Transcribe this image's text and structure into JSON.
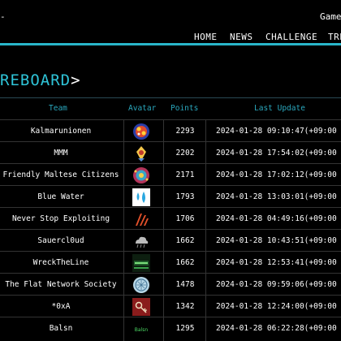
{
  "header": {
    "brand_fragment": "-",
    "site_title": "Game",
    "nav": [
      "HOME",
      "NEWS",
      "CHALLENGE",
      "TRE"
    ]
  },
  "page_title": "REBOARD",
  "page_title_caret": ">",
  "table": {
    "columns": [
      "Team",
      "Avatar",
      "Points",
      "Last Update"
    ],
    "rows": [
      {
        "team": "Kalmarunionen",
        "avatar": "kalmar-avatar-icon",
        "points": "2293",
        "update": "2024-01-28 09:10:47(+09:00"
      },
      {
        "team": "MMM",
        "avatar": "mmm-avatar-icon",
        "points": "2202",
        "update": "2024-01-28 17:54:02(+09:00"
      },
      {
        "team": "Friendly Maltese Citizens",
        "avatar": "fmc-avatar-icon",
        "points": "2171",
        "update": "2024-01-28 17:02:12(+09:00"
      },
      {
        "team": "Blue Water",
        "avatar": "blue-water-avatar-icon",
        "points": "1793",
        "update": "2024-01-28 13:03:01(+09:00"
      },
      {
        "team": "Never Stop Exploiting",
        "avatar": "nse-avatar-icon",
        "points": "1706",
        "update": "2024-01-28 04:49:16(+09:00"
      },
      {
        "team": "Sauercl0ud",
        "avatar": "sauercloud-avatar-icon",
        "points": "1662",
        "update": "2024-01-28 10:43:51(+09:00"
      },
      {
        "team": "WreckTheLine",
        "avatar": "wrecktheline-avatar-icon",
        "points": "1662",
        "update": "2024-01-28 12:53:41(+09:00"
      },
      {
        "team": "The Flat Network Society",
        "avatar": "flat-network-avatar-icon",
        "points": "1478",
        "update": "2024-01-28 09:59:06(+09:00"
      },
      {
        "team": "*0xA",
        "avatar": "0xa-avatar-icon",
        "points": "1342",
        "update": "2024-01-28 12:24:00(+09:00"
      },
      {
        "team": "Balsn",
        "avatar": "balsn-avatar-icon",
        "points": "1295",
        "update": "2024-01-28 06:22:28(+09:00"
      }
    ],
    "balsn_avatar_text": "Balsn"
  },
  "colors": {
    "accent": "#29b6c9",
    "background": "#000000",
    "grid": "#333333"
  }
}
